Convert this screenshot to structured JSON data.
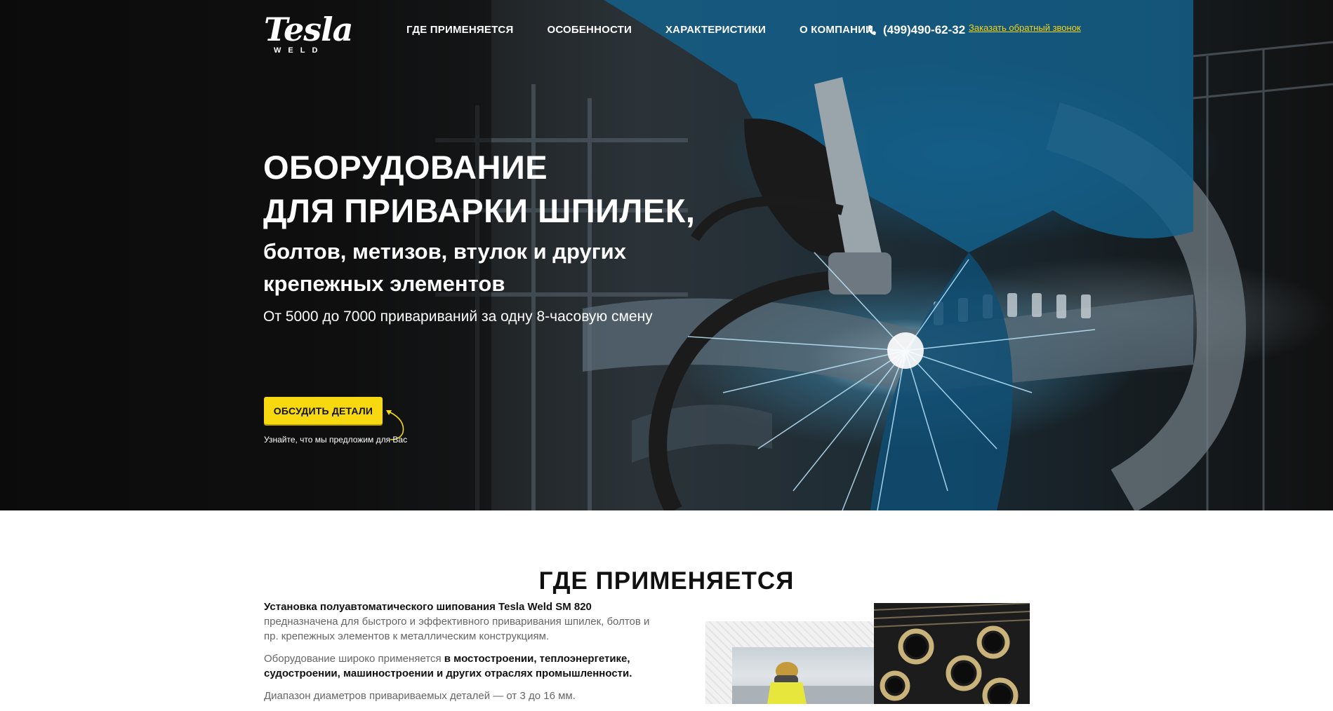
{
  "header": {
    "logo_main": "Tesla",
    "logo_sub": "WELD",
    "nav": [
      {
        "label": "ГДЕ ПРИМЕНЯЕТСЯ"
      },
      {
        "label": "ОСОБЕННОСТИ"
      },
      {
        "label": "ХАРАКТЕРИСТИКИ"
      },
      {
        "label": "О КОМПАНИИ"
      }
    ],
    "phone": "(499)490-62-32",
    "callback_link": "Заказать обратный звонок"
  },
  "hero": {
    "title_line1": "ОБОРУДОВАНИЕ",
    "title_line2": "ДЛЯ ПРИВАРКИ ШПИЛЕК,",
    "subtitle_line1": "болтов, метизов, втулок и других",
    "subtitle_line2": "крепежных элементов",
    "description": "От 5000 до 7000 привариваний за одну 8-часовую смену",
    "cta_label": "ОБСУДИТЬ ДЕТАЛИ",
    "cta_hint": "Узнайте, что мы предложим для Вас"
  },
  "section": {
    "title": "ГДЕ ПРИМЕНЯЕТСЯ",
    "p1_bold": "Установка полуавтоматического шипования Tesla Weld SM 820",
    "p1_text": "предназначена для быстрого и эффективного приваривания шпилек, болтов и пр. крепежных элементов к металлическим конструкциям.",
    "p2_text": "Оборудование широко применяется",
    "p2_bold": "в мостостроении, теплоэнергетике, судостроении, машиностроении и других отраслях промышленности.",
    "p3_text": "Диапазон диаметров привариваемых деталей — от 3 до 16 мм."
  },
  "colors": {
    "accent": "#f8d80f",
    "link": "#f4d31a",
    "dark": "#111111"
  },
  "icons": {
    "phone": "phone-icon",
    "arrow": "curved-arrow-icon"
  }
}
